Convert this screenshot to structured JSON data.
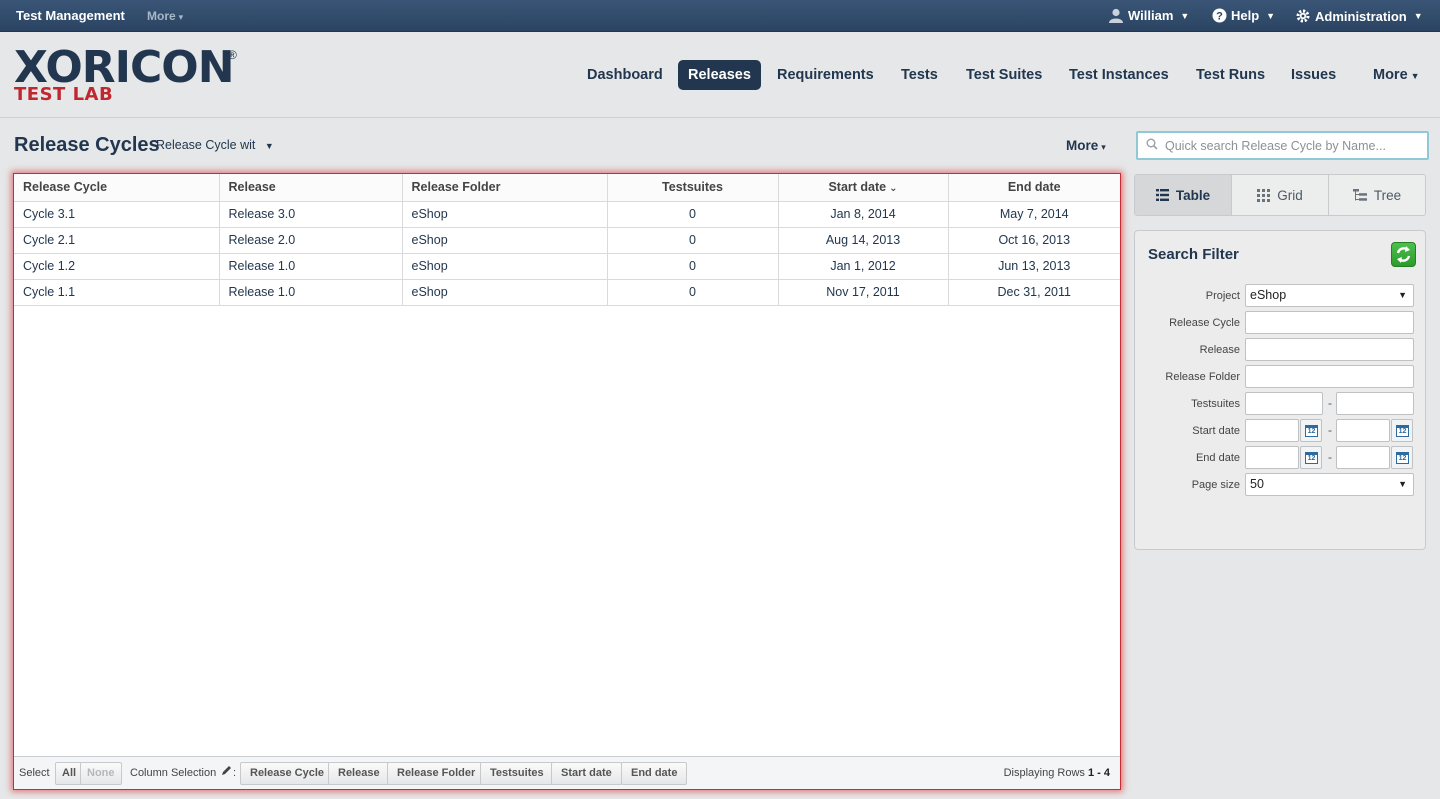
{
  "topbar": {
    "app_name": "Test Management",
    "more": "More",
    "user": "William",
    "help": "Help",
    "admin": "Administration"
  },
  "logo": {
    "main": "XORICON",
    "reg": "®",
    "sub": "TEST LAB"
  },
  "nav": {
    "items": [
      "Dashboard",
      "Releases",
      "Requirements",
      "Tests",
      "Test Suites",
      "Test Instances",
      "Test Runs",
      "Issues"
    ],
    "active": "Releases",
    "more": "More"
  },
  "page": {
    "title": "Release Cycles",
    "view_select": "Release Cycle wit",
    "more": "More"
  },
  "search": {
    "placeholder": "Quick search Release Cycle by Name..."
  },
  "table": {
    "columns": [
      "Release Cycle",
      "Release",
      "Release Folder",
      "Testsuites",
      "Start date",
      "End date"
    ],
    "sorted_column": "Start date",
    "rows": [
      [
        "Cycle 3.1",
        "Release 3.0",
        "eShop",
        "0",
        "Jan 8, 2014",
        "May 7, 2014"
      ],
      [
        "Cycle 2.1",
        "Release 2.0",
        "eShop",
        "0",
        "Aug 14, 2013",
        "Oct 16, 2013"
      ],
      [
        "Cycle 1.2",
        "Release 1.0",
        "eShop",
        "0",
        "Jan 1, 2012",
        "Jun 13, 2013"
      ],
      [
        "Cycle 1.1",
        "Release 1.0",
        "eShop",
        "0",
        "Nov 17, 2011",
        "Dec 31, 2011"
      ]
    ]
  },
  "footer": {
    "select_label": "Select",
    "all": "All",
    "none": "None",
    "column_selection": "Column Selection",
    "column_buttons": [
      "Release Cycle",
      "Release",
      "Release Folder",
      "Testsuites",
      "Start date",
      "End date"
    ],
    "displaying_label": "Displaying Rows",
    "displaying_range": "1 - 4"
  },
  "view_tabs": {
    "table": "Table",
    "grid": "Grid",
    "tree": "Tree",
    "active": "Table"
  },
  "filter": {
    "title": "Search Filter",
    "project_label": "Project",
    "project_value": "eShop",
    "release_cycle_label": "Release Cycle",
    "release_label": "Release",
    "release_folder_label": "Release Folder",
    "testsuites_label": "Testsuites",
    "start_date_label": "Start date",
    "end_date_label": "End date",
    "page_size_label": "Page size",
    "page_size_value": "50",
    "range_sep": "-",
    "calendar_day": "12"
  },
  "colors": {
    "navy": "#22374f",
    "accent_red": "#c0282f",
    "refresh_green": "#3cb03c"
  }
}
